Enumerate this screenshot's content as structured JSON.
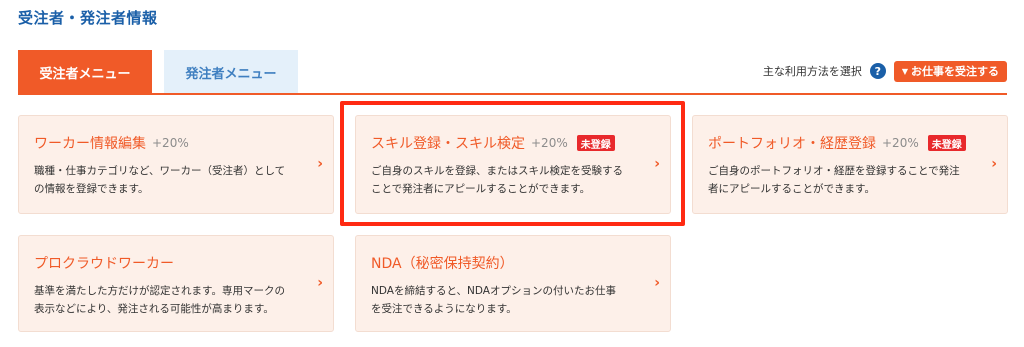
{
  "page": {
    "title": "受注者・発注者情報"
  },
  "tabs": [
    {
      "label": "受注者メニュー",
      "active": true
    },
    {
      "label": "発注者メニュー",
      "active": false
    }
  ],
  "usage": {
    "label": "主な利用方法を選択",
    "help_icon": "?",
    "button_caret": "▼",
    "button_label": "お仕事を受注する"
  },
  "cards": [
    {
      "title": "ワーカー情報編集",
      "bonus": "+20%",
      "badge": "",
      "desc_line1": "職種・仕事カテゴリなど、ワーカー（受注者）として",
      "desc_line2": "の情報を登録できます。",
      "arrow": "›"
    },
    {
      "title": "スキル登録・スキル検定",
      "bonus": "+20%",
      "badge": "未登録",
      "desc_line1": "ご自身のスキルを登録、またはスキル検定を受験する",
      "desc_line2": "ことで発注者にアピールすることができます。",
      "arrow": "›"
    },
    {
      "title": "ポートフォリオ・経歴登録",
      "bonus": "+20%",
      "badge": "未登録",
      "desc_line1": "ご自身のポートフォリオ・経歴を登録することで発注",
      "desc_line2": "者にアピールすることができます。",
      "arrow": "›"
    },
    {
      "title": "プロクラウドワーカー",
      "bonus": "",
      "badge": "",
      "desc_line1": "基準を満たした方だけが認定されます。専用マークの",
      "desc_line2": "表示などにより、発注される可能性が高まります。",
      "arrow": "›"
    },
    {
      "title": "NDA（秘密保持契約）",
      "bonus": "",
      "badge": "",
      "desc_line1": "NDAを締結すると、NDAオプションの付いたお仕事",
      "desc_line2": "を受注できるようになります。",
      "arrow": "›"
    }
  ],
  "colors": {
    "accent": "#f05a28",
    "title_blue": "#1a5fa8",
    "badge_red": "#e8292c",
    "highlight": "#ff2a12",
    "card_bg": "#fdf0e9"
  }
}
